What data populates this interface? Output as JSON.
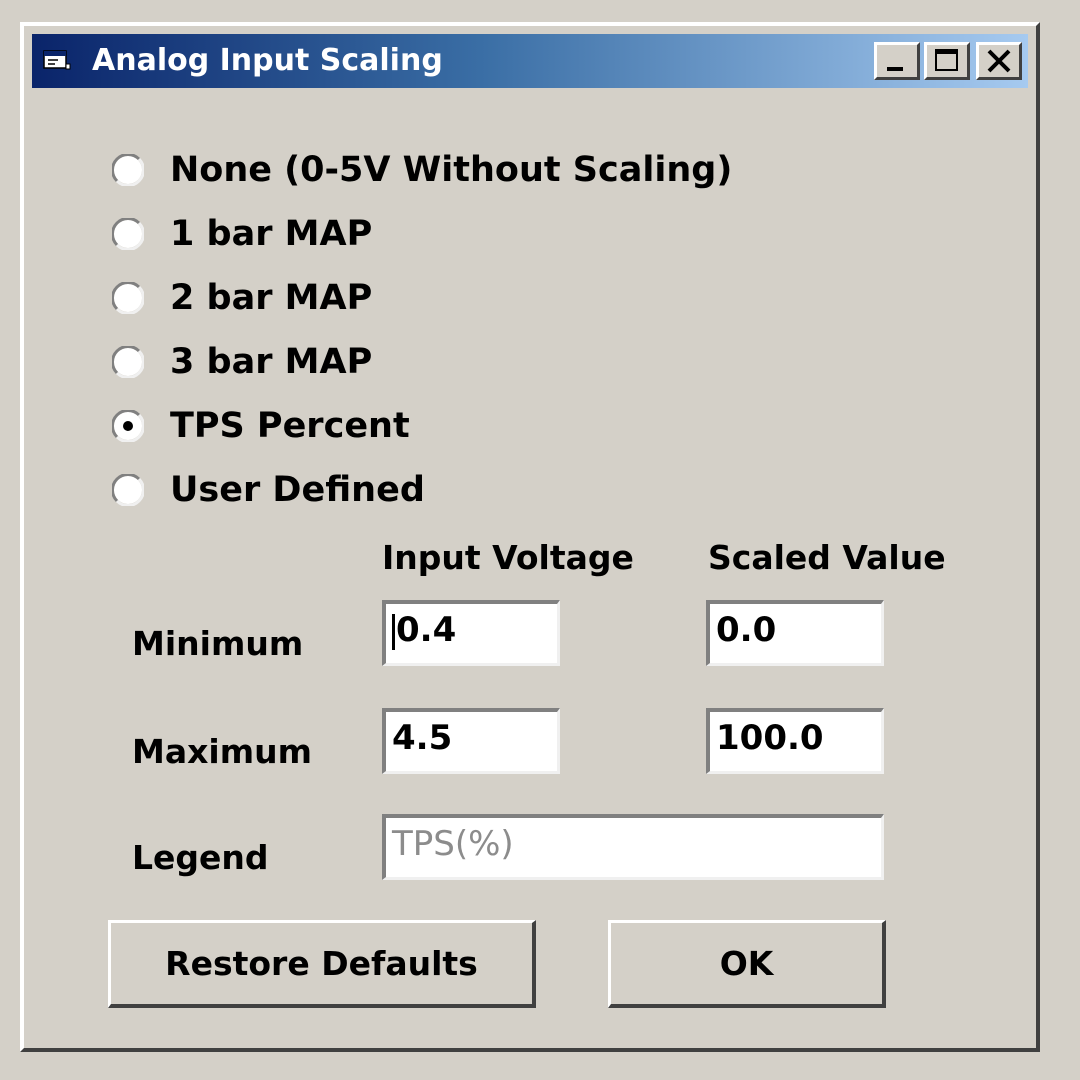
{
  "window": {
    "title": "Analog Input Scaling",
    "icon": "app-window-icon",
    "controls": [
      "minimize-icon",
      "maximize-icon",
      "close-icon"
    ]
  },
  "scaling_options": [
    {
      "label": "None (0-5V Without Scaling)",
      "selected": false
    },
    {
      "label": "1 bar MAP",
      "selected": false
    },
    {
      "label": "2 bar MAP",
      "selected": false
    },
    {
      "label": "3 bar MAP",
      "selected": false
    },
    {
      "label": "TPS Percent",
      "selected": true
    },
    {
      "label": "User Defined",
      "selected": false
    }
  ],
  "table": {
    "col_input": "Input Voltage",
    "col_scaled": "Scaled Value",
    "row_minimum": "Minimum",
    "row_maximum": "Maximum",
    "row_legend": "Legend",
    "min_input": "0.4",
    "min_scaled": "0.0",
    "max_input": "4.5",
    "max_scaled": "100.0",
    "legend_value": "TPS(%)"
  },
  "buttons": {
    "restore": "Restore Defaults",
    "ok": "OK"
  },
  "colors": {
    "face": "#d4d0c8",
    "title_start": "#0a246a",
    "title_end": "#a6caf0",
    "disabled_text": "#8c8c8c"
  }
}
